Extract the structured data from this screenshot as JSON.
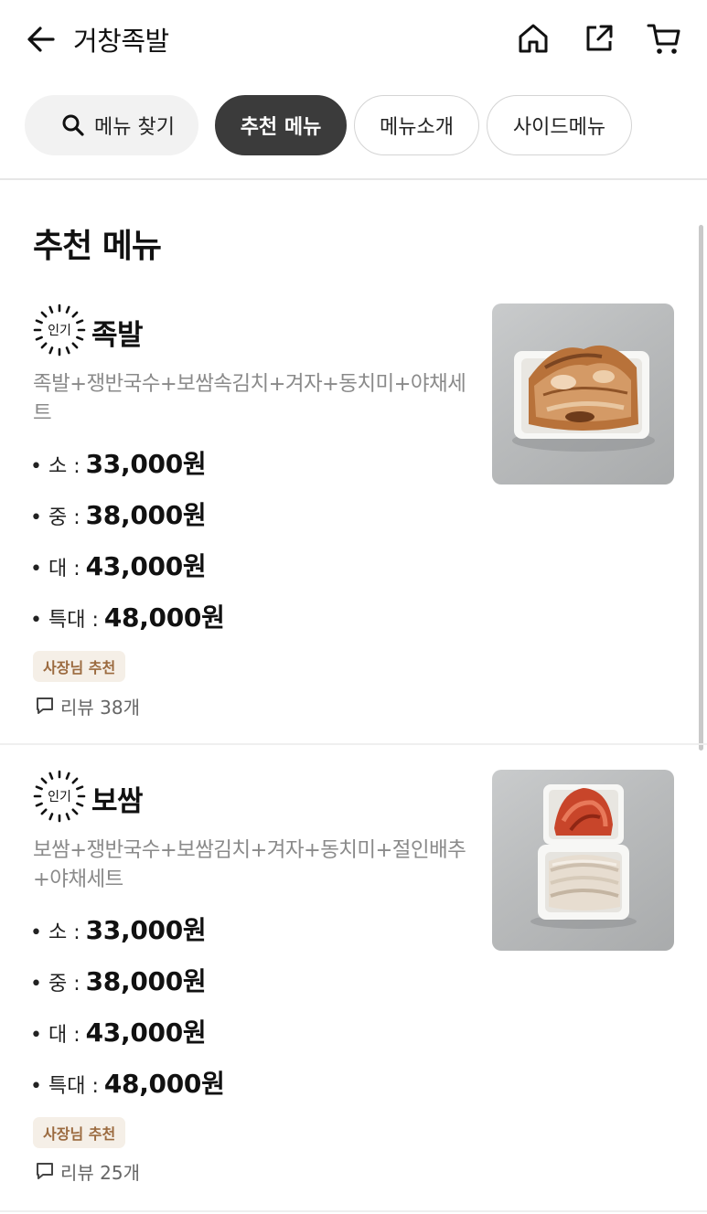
{
  "header": {
    "title": "거창족발",
    "icons": [
      "back-arrow-icon",
      "home-icon",
      "share-icon",
      "cart-icon"
    ]
  },
  "filters": {
    "search_label": "메뉴 찾기",
    "tabs": [
      {
        "label": "추천 메뉴",
        "active": true
      },
      {
        "label": "메뉴소개",
        "active": false
      },
      {
        "label": "사이드메뉴",
        "active": false
      }
    ]
  },
  "section": {
    "title": "추천 메뉴"
  },
  "items": [
    {
      "badge": "인기",
      "name": "족발",
      "description": "족발+쟁반국수+보쌈속김치+겨자+동치미+야채세트",
      "prices": [
        {
          "label": "• 소 : ",
          "value": "33,000원"
        },
        {
          "label": "• 중 : ",
          "value": "38,000원"
        },
        {
          "label": "• 대 : ",
          "value": "43,000원"
        },
        {
          "label": "• 특대 : ",
          "value": "48,000원"
        }
      ],
      "tag": "사장님 추천",
      "reviews": "리뷰 38개"
    },
    {
      "badge": "인기",
      "name": "보쌈",
      "description": "보쌈+쟁반국수+보쌈김치+겨자+동치미+절인배추+야채세트",
      "prices": [
        {
          "label": "• 소 : ",
          "value": "33,000원"
        },
        {
          "label": "• 중 : ",
          "value": "38,000원"
        },
        {
          "label": "• 대 : ",
          "value": "43,000원"
        },
        {
          "label": "• 특대 : ",
          "value": "48,000원"
        }
      ],
      "tag": "사장님 추천",
      "reviews": "리뷰 25개"
    }
  ],
  "colors": {
    "active_chip": "#3b3b3b",
    "tag_bg": "#f5efe7",
    "tag_text": "#9b6a3f",
    "description": "#8a8a8a"
  }
}
